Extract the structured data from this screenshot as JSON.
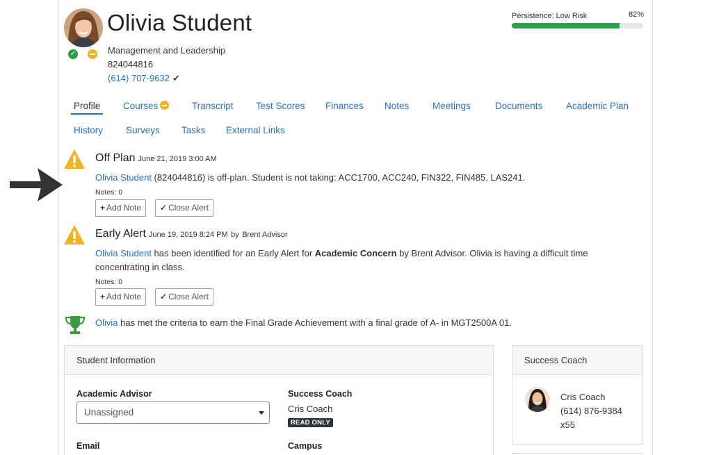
{
  "student": {
    "name": "Olivia Student",
    "program": "Management and Leadership",
    "id": "824044816",
    "phone": "(614) 707-9632",
    "phone_verified_icon": "check-icon",
    "status_icons": [
      "status-ok-icon",
      "status-warning-icon"
    ]
  },
  "persistence": {
    "label": "Persistence: Low Risk",
    "percent_label": "82%",
    "value": 0.82,
    "bar_color": "#2aa048"
  },
  "tabs": [
    {
      "label": "Profile",
      "active": true
    },
    {
      "label": "Courses",
      "badge": "warning"
    },
    {
      "label": "Transcript"
    },
    {
      "label": "Test Scores"
    },
    {
      "label": "Finances"
    },
    {
      "label": "Notes"
    },
    {
      "label": "Meetings"
    },
    {
      "label": "Documents"
    },
    {
      "label": "Academic Plan"
    },
    {
      "label": "History"
    },
    {
      "label": "Surveys"
    },
    {
      "label": "Tasks"
    },
    {
      "label": "External Links"
    }
  ],
  "alerts": [
    {
      "title": "Off Plan",
      "date": "June 21, 2019 3:00 AM",
      "body_link": "Olivia Student",
      "body_text": " (824044816) is off-plan. Student is not taking: ACC1700, ACC240, FIN322, FIN485, LAS241.",
      "notes": "Notes: 0",
      "add_note": "Add Note",
      "close_alert": "Close Alert"
    },
    {
      "title": "Early Alert",
      "date": "June 19, 2019 8:24 PM",
      "by_text": "by",
      "by_link": "Brent Advisor",
      "body_link": "Olivia Student",
      "body_pre": " has been identified for an Early Alert for ",
      "body_bold": "Academic Concern",
      "body_post": " by Brent Advisor. Olivia is having a difficult time concentrating in class.",
      "notes": "Notes: 0",
      "add_note": "Add Note",
      "close_alert": "Close Alert"
    }
  ],
  "achievement": {
    "link": "Olivia",
    "text": " has met the criteria to earn the Final Grade Achievement with a final grade of A- in MGT2500A 01."
  },
  "student_info": {
    "heading": "Student Information",
    "advisor_label": "Academic Advisor",
    "advisor_value": "Unassigned",
    "coach_label": "Success Coach",
    "coach_value": "Cris Coach",
    "readonly_badge": "READ ONLY",
    "email_label": "Email",
    "campus_label": "Campus"
  },
  "success_coach": {
    "heading": "Success Coach",
    "name": "Cris Coach",
    "phone": "(614) 876-9384",
    "ext": "x55"
  },
  "colors": {
    "link": "#2a6fba",
    "warning": "#f0b323",
    "success": "#2e9b3e",
    "trophy": "#3a9b3a"
  }
}
